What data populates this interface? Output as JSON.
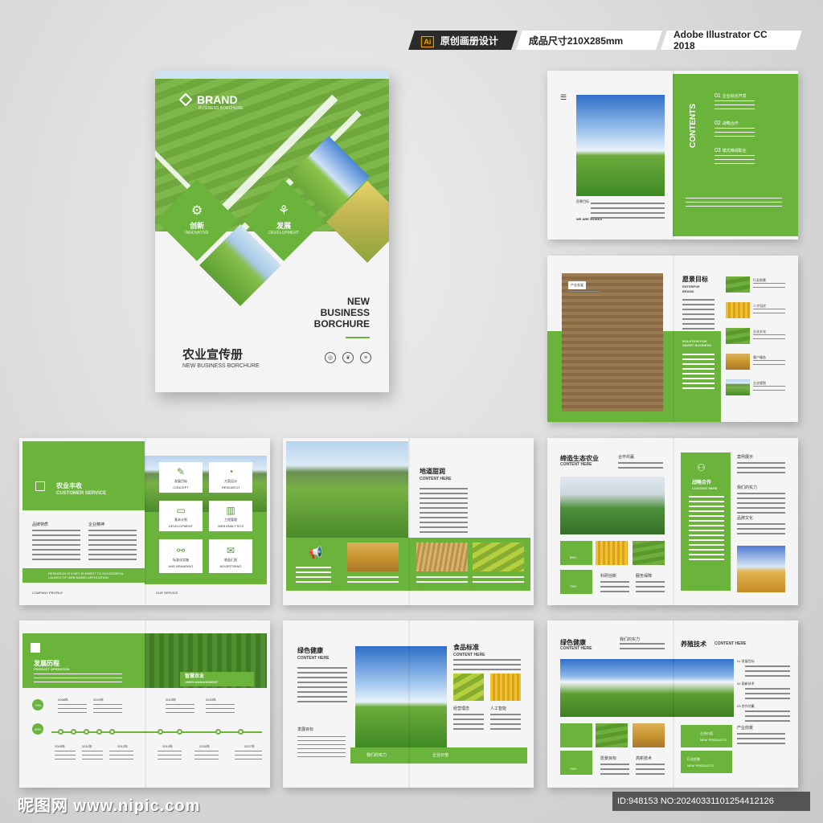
{
  "topbar": {
    "ai_badge": "Ai",
    "design_label": "原创画册设计",
    "size_label": "成品尺寸210X285mm",
    "software_label": "Adobe Illustrator CC 2018"
  },
  "cover": {
    "brand": "BRAND",
    "brand_sub": "BUSINESS BORCHURE",
    "diamond1_cn": "创新",
    "diamond1_en": "INNOVATIVE",
    "diamond2_cn": "发展",
    "diamond2_en": "DEVELOPMENT",
    "title_en_1": "NEW",
    "title_en_2": "BUSINESS",
    "title_en_3": "BORCHURE",
    "title_cn": "农业宣传册",
    "subtitle_en": "NEW BUSINESS BORCHURE"
  },
  "spread_contents": {
    "contents_label": "CONTENTS",
    "items": [
      {
        "num": "01",
        "label": "企业综合开发"
      },
      {
        "num": "02",
        "label": "战略合作"
      },
      {
        "num": "03",
        "label": "模式推阔职业"
      }
    ],
    "photo_caption": "愿景目标",
    "photo_caption_en": "WE ARE WORKS"
  },
  "spread_vision": {
    "tag": "产业发展",
    "title_cn": "愿景目标",
    "title_en1": "ENTERPSE",
    "title_en2": "BRAND",
    "solution": "SOLUTION FOR SMART BUSINESS",
    "list": [
      "行业前景",
      "人才培优",
      "企业文化",
      "客户服务",
      "企业规划"
    ]
  },
  "spread_customer": {
    "title_cn": "农业丰收",
    "title_en": "CUSTOMER SERVICE",
    "col1": "品牌特质",
    "col2": "企业精神",
    "boxes": [
      {
        "cn": "发展目标",
        "en": "CONCEPT"
      },
      {
        "cn": "方案设计",
        "en": "RESEARCH"
      },
      {
        "cn": "基本计划",
        "en": "DEVELOPMENT"
      },
      {
        "cn": "工程管理",
        "en": "WEB ANALYTICS"
      },
      {
        "cn": "标准化实施",
        "en": "AND BRANDING"
      },
      {
        "cn": "收益汇报",
        "en": "ADVERTISING"
      }
    ],
    "footer_left": "COMPANY PROFILE",
    "footer_right": "OUR SERVICE",
    "research": "RESEARCH IS A KEY ELEMENT TO SUCCESSFUL LAUNCH OF WEB BASED APPLICATION"
  },
  "spread_land": {
    "title_cn": "地道甜润",
    "title_en": "CONTENT HERE"
  },
  "spread_eco": {
    "title_cn": "缔造生态农业",
    "title_en": "CONTENT HERE",
    "coop": "合作共赢",
    "strategy_cn": "战略合作",
    "strategy_en": "CONTENT HERE",
    "stat1": "850+",
    "stat2": "750+",
    "tech": "科研创新",
    "service": "服务保障",
    "right": [
      "案例展示",
      "我们的实力",
      "品牌文化"
    ]
  },
  "spread_history": {
    "title_cn": "发展历程",
    "title_en": "PRODUCT OPERATION",
    "smart_cn": "智慧农业",
    "smart_en": "USER MANAGEMENT",
    "pct1": "75%",
    "pct2": "80%",
    "years_top": [
      "2008年",
      "2010年",
      "2013年",
      "2015年"
    ],
    "years_bottom": [
      "2009年",
      "2011年",
      "2012年",
      "2014年",
      "2016年",
      "2017年"
    ]
  },
  "spread_green": {
    "title_cn": "绿色健康",
    "title_en": "CONTENT HERE",
    "food_cn": "食品标准",
    "food_en": "CONTENT HERE",
    "concept": "经营理念",
    "ai": "人工智能",
    "goal": "发展目标",
    "power": "我们的实力",
    "dev": "企业价值"
  },
  "spread_breed": {
    "title_cn": "绿色健康",
    "title_en": "CONTENT HERE",
    "power": "我们的实力",
    "tech_cn": "养殖技术",
    "tech_en": "CONTENT HERE",
    "list": [
      {
        "num": "01",
        "label": "发展目标"
      },
      {
        "num": "02",
        "label": "高新技术"
      },
      {
        "num": "03",
        "label": "合作共赢"
      }
    ],
    "industry": "产业前景",
    "new1_cn": "企业价值",
    "new1_en": "NEW PRODUCTS",
    "new2_cn": "行业前景",
    "new2_en": "NEW PRODUCTS",
    "vision": "愿景目标",
    "hitech": "高新技术",
    "stat": "750+"
  },
  "footer": {
    "watermark": "昵图网 www.nipic.com",
    "id": "ID:948153 NO:20240331101254412126"
  },
  "colors": {
    "accent": "#6ab43c",
    "accent_dark": "#4e9a2b"
  }
}
